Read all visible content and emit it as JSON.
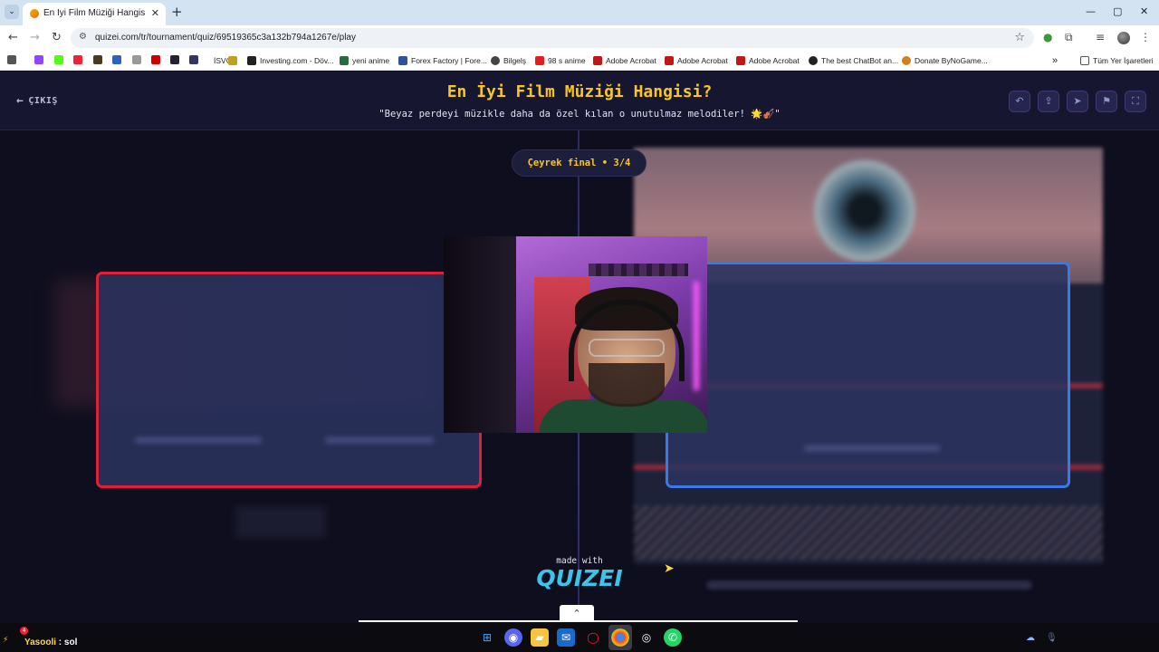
{
  "browser": {
    "tab_title": "En İyi Film Müziği Hangisi? - Ti",
    "tab_close": "✕",
    "new_tab": "+",
    "url": "quizei.com/tr/tournament/quiz/69519365c3a132b794a1267e/play",
    "window_controls": [
      "—",
      "▢",
      "✕"
    ],
    "bookmarks": [
      {
        "label": "İSVG",
        "color": "#c0a020"
      },
      {
        "label": "Investing.com - Döv...",
        "color": "#222222"
      },
      {
        "label": "yeni anime",
        "color": "#2a6a40"
      },
      {
        "label": "Forex Factory | Fore...",
        "color": "#3050a0"
      },
      {
        "label": "Bilgelş",
        "color": "#444444"
      },
      {
        "label": "98 s anime",
        "color": "#e02020"
      },
      {
        "label": "Adobe Acrobat",
        "color": "#c01818"
      },
      {
        "label": "Adobe Acrobat",
        "color": "#c01818"
      },
      {
        "label": "Adobe Acrobat",
        "color": "#c01818"
      },
      {
        "label": "The best ChatBot an...",
        "color": "#222222"
      },
      {
        "label": "Donate ByNoGame...",
        "color": "#d08020"
      }
    ],
    "all_bookmarks": "Tüm Yer İşaretleri"
  },
  "page": {
    "exit_label": "ÇIKIŞ",
    "title": "En İyi Film Müziği Hangisi?",
    "subtitle": "\"Beyaz perdeyi müzikle daha da özel kılan o unutulmaz melodiler! 🌟🎻\"",
    "round": "Çeyrek final • 3/4",
    "made_with": "made with",
    "logo": "QUIZEI"
  },
  "header_icons": [
    "undo-icon",
    "share-icon",
    "send-icon",
    "flag-icon",
    "fullscreen-icon"
  ],
  "taskbar": {
    "stream_user": "Yasooli",
    "stream_command": ": sol",
    "notif_count": "4"
  },
  "colors": {
    "accent_yellow": "#f7c624",
    "left_card_border": "#e0203a",
    "right_card_border": "#3b78e8",
    "logo_cyan": "#3ec3e8"
  }
}
